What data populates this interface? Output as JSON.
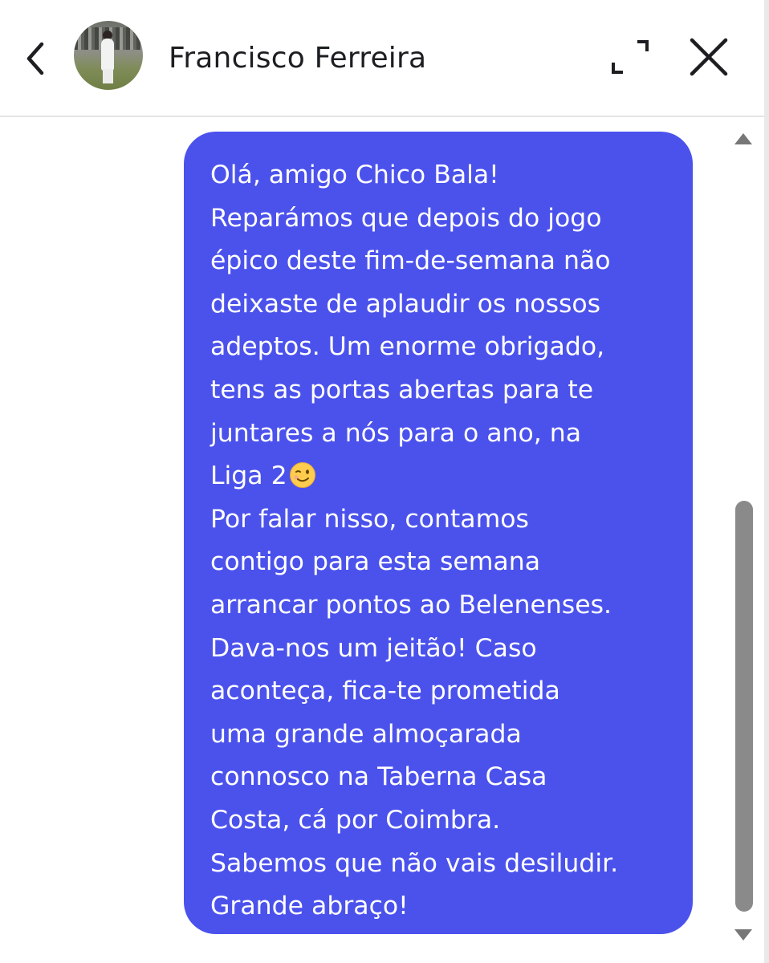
{
  "header": {
    "contact_name": "Francisco Ferreira",
    "back_icon": "chevron-left-icon",
    "expand_icon": "expand-icon",
    "close_icon": "close-icon"
  },
  "message": {
    "text_before_emoji": "Olá, amigo Chico Bala!\nReparámos que depois do jogo\népico deste fim-de-semana não\ndeixaste de aplaudir os nossos\nadeptos. Um enorme obrigado,\ntens as portas abertas para te\njuntares a nós para o ano, na\nLiga 2",
    "emoji": "winking-face-emoji",
    "text_after_emoji": "\nPor falar nisso, contamos\ncontigo para esta semana\narrancar pontos ao Belenenses.\nDava-nos um jeitão! Caso\naconteça, fica-te prometida\numa grande almoçarada\nconnosco na Taberna Casa\nCosta, cá por Coimbra.\nSabemos que não vais desiludir.\nGrande abraço!",
    "bubble_color": "#4b52ec",
    "text_color": "#ffffff"
  }
}
